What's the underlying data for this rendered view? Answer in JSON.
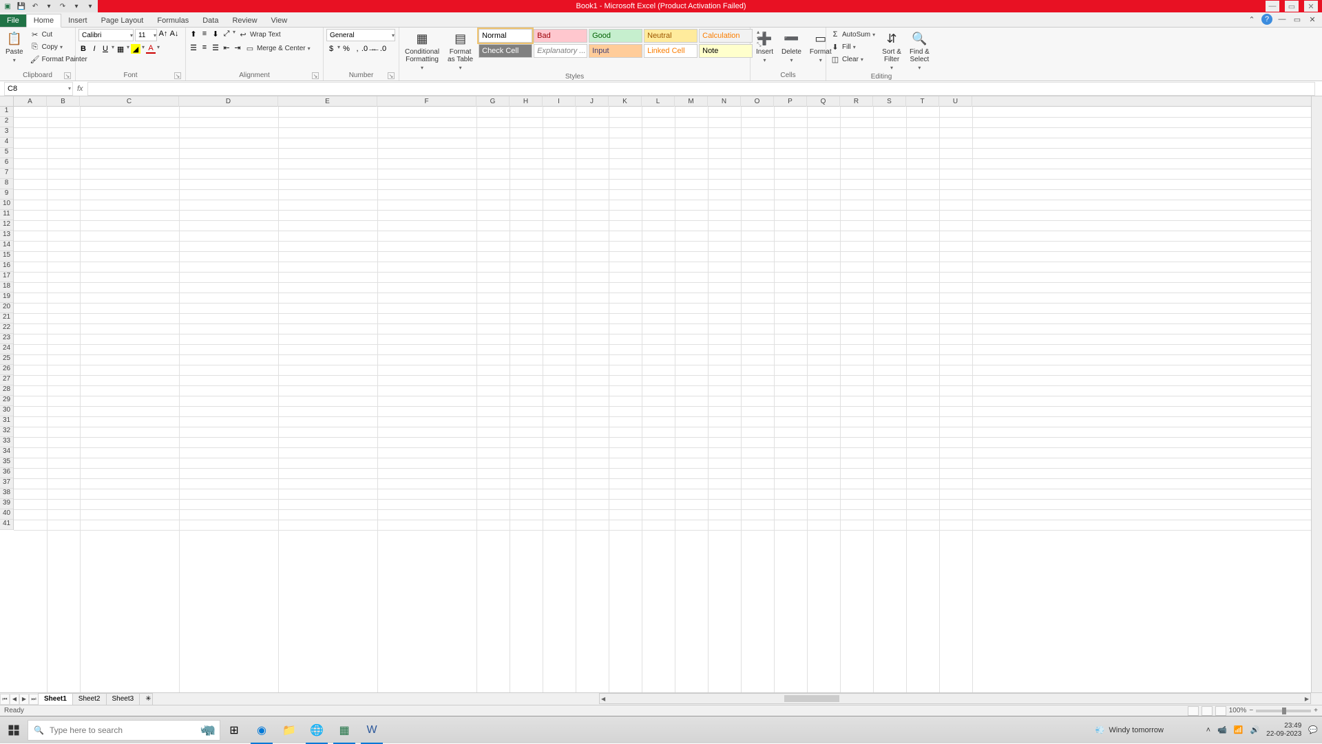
{
  "title": "Book1 - Microsoft Excel (Product Activation Failed)",
  "qat": {
    "save": "💾",
    "undo": "↶",
    "redo": "↷",
    "dropdown": "▾"
  },
  "tabs": {
    "file": "File",
    "list": [
      "Home",
      "Insert",
      "Page Layout",
      "Formulas",
      "Data",
      "Review",
      "View"
    ],
    "active": "Home"
  },
  "ribbon": {
    "clipboard": {
      "label": "Clipboard",
      "paste": "Paste",
      "cut": "Cut",
      "copy": "Copy",
      "format_painter": "Format Painter"
    },
    "font": {
      "label": "Font",
      "name": "Calibri",
      "size": "11"
    },
    "alignment": {
      "label": "Alignment",
      "wrap": "Wrap Text",
      "merge": "Merge & Center"
    },
    "number": {
      "label": "Number",
      "format": "General"
    },
    "styles": {
      "label": "Styles",
      "conditional": "Conditional\nFormatting",
      "format_table": "Format\nas Table",
      "cells": [
        {
          "t": "Normal",
          "bg": "#fff",
          "fg": "#000",
          "selected": true
        },
        {
          "t": "Bad",
          "bg": "#ffc7ce",
          "fg": "#9c0006"
        },
        {
          "t": "Good",
          "bg": "#c6efce",
          "fg": "#006100"
        },
        {
          "t": "Neutral",
          "bg": "#ffeb9c",
          "fg": "#9c5700"
        },
        {
          "t": "Calculation",
          "bg": "#f2f2f2",
          "fg": "#fa7d00"
        },
        {
          "t": "Check Cell",
          "bg": "#808080",
          "fg": "#fff"
        },
        {
          "t": "Explanatory ...",
          "bg": "#fff",
          "fg": "#7f7f7f",
          "italic": true
        },
        {
          "t": "Input",
          "bg": "#ffcc99",
          "fg": "#3f3f76"
        },
        {
          "t": "Linked Cell",
          "bg": "#fff",
          "fg": "#fa7d00"
        },
        {
          "t": "Note",
          "bg": "#ffffcc",
          "fg": "#000"
        }
      ]
    },
    "cells": {
      "label": "Cells",
      "insert": "Insert",
      "delete": "Delete",
      "format": "Format"
    },
    "editing": {
      "label": "Editing",
      "autosum": "AutoSum",
      "fill": "Fill",
      "clear": "Clear",
      "sort": "Sort &\nFilter",
      "find": "Find &\nSelect"
    }
  },
  "namebox": "C8",
  "formula": "",
  "columns": [
    "A",
    "B",
    "C",
    "D",
    "E",
    "F",
    "G",
    "H",
    "I",
    "J",
    "K",
    "L",
    "M",
    "N",
    "O",
    "P",
    "Q",
    "R",
    "S",
    "T",
    "U"
  ],
  "rows_count": 41,
  "sheets": {
    "list": [
      "Sheet1",
      "Sheet2",
      "Sheet3"
    ],
    "active": "Sheet1"
  },
  "status": {
    "ready": "Ready",
    "zoom": "100%"
  },
  "taskbar": {
    "search_placeholder": "Type here to search",
    "weather": "Windy tomorrow",
    "time": "23:49",
    "date": "22-09-2023"
  }
}
